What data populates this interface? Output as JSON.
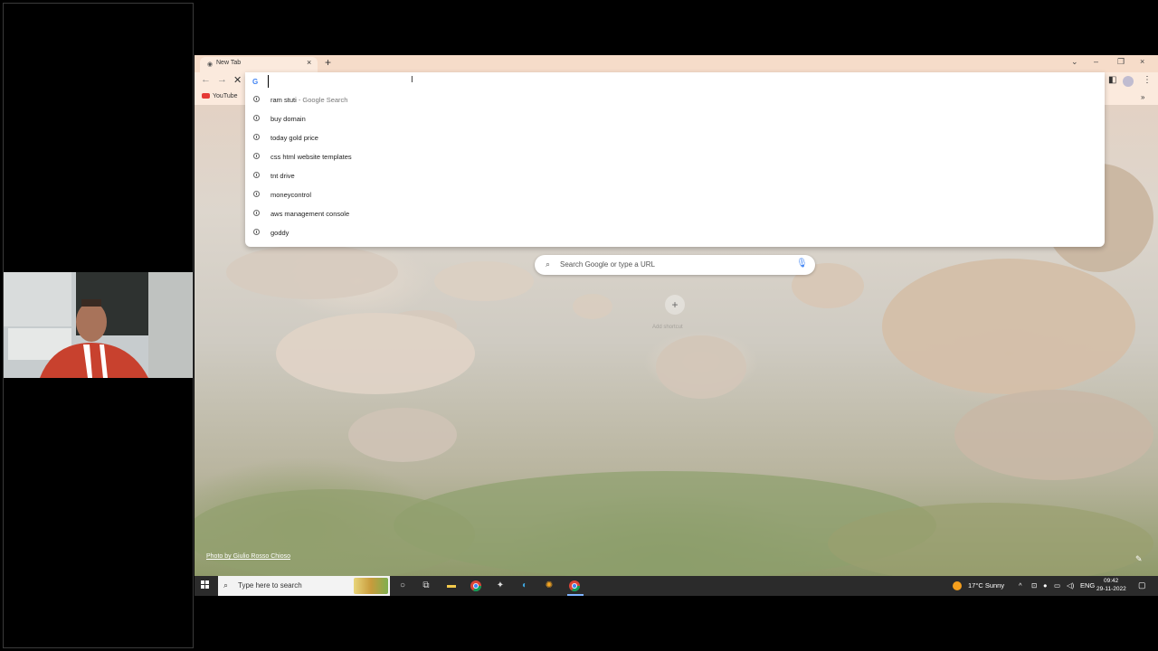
{
  "browser": {
    "tab_title": "New Tab",
    "tab_close": "×",
    "new_tab": "+",
    "window_controls": {
      "dropdown": "⌄",
      "minimize": "–",
      "restore": "❐",
      "close": "×"
    },
    "nav": {
      "back": "←",
      "forward": "→",
      "stop": "✕"
    },
    "bookmarks": [
      {
        "label": "YouTube"
      }
    ],
    "bookmarks_more": "»"
  },
  "omnibox": {
    "value": "",
    "placeholder": "",
    "suggestions": [
      {
        "text": "ram stuti",
        "suffix": " - Google Search"
      },
      {
        "text": "buy domain",
        "suffix": ""
      },
      {
        "text": "today gold price",
        "suffix": ""
      },
      {
        "text": "css html website templates",
        "suffix": ""
      },
      {
        "text": "tnt drive",
        "suffix": ""
      },
      {
        "text": "moneycontrol",
        "suffix": ""
      },
      {
        "text": "aws management console",
        "suffix": ""
      },
      {
        "text": "goddy",
        "suffix": ""
      }
    ]
  },
  "ntp": {
    "search_placeholder": "Search Google or type a URL",
    "add_shortcut_symbol": "+",
    "add_shortcut_label": "Add shortcut",
    "photo_credit": "Photo by Giulio Rosso Chioso"
  },
  "taskbar": {
    "search_placeholder": "Type here to search",
    "weather": "17°C  Sunny",
    "language": "ENG",
    "time": "09:42",
    "date": "29-11-2022"
  },
  "colors": {
    "tab_strip": "#f6dcc9",
    "toolbar": "#fbeadd",
    "taskbar": "#2b2b2b",
    "weather_sun": "#f59f1d",
    "youtube_red": "#e53935"
  },
  "icons": {
    "omnibox": "google-g-icon",
    "suggestion": "history-clock-icon",
    "ntp_search": "search-icon",
    "ntp_voice": "microphone-icon"
  }
}
